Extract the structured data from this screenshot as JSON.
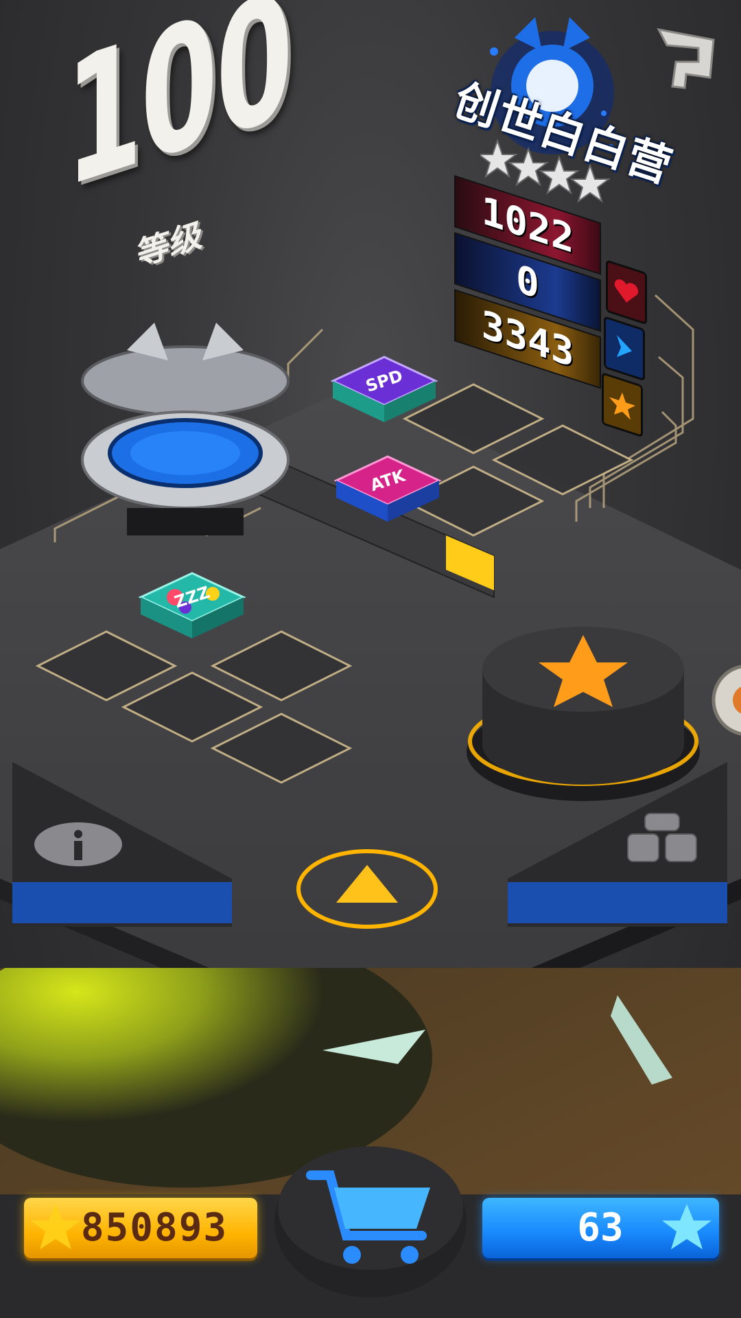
{
  "level": {
    "number": "100",
    "label": "等级"
  },
  "character": {
    "name": "创世白白营",
    "stars": 4
  },
  "stats": {
    "hp": "1022",
    "speed": "0",
    "power": "3343"
  },
  "icons": {
    "help": "question-mark-icon",
    "hp": "heart-icon",
    "speed": "chevron-right-icon",
    "power": "star-icon",
    "info": "info-icon",
    "team": "team-icon",
    "up": "up-arrow-icon",
    "center": "star-icon",
    "shop": "shopping-cart-icon"
  },
  "tiles": [
    {
      "label": "SPD",
      "color": "#6b2fd6"
    },
    {
      "label": "ATK",
      "color": "#d6238a"
    },
    {
      "label": "ZZZ",
      "color": "#23b8a8"
    }
  ],
  "currency": {
    "coins": "850893",
    "gems": "63"
  },
  "colors": {
    "coins": "#ffb400",
    "gems": "#1a8cff",
    "accent": "#ff9c1a"
  }
}
